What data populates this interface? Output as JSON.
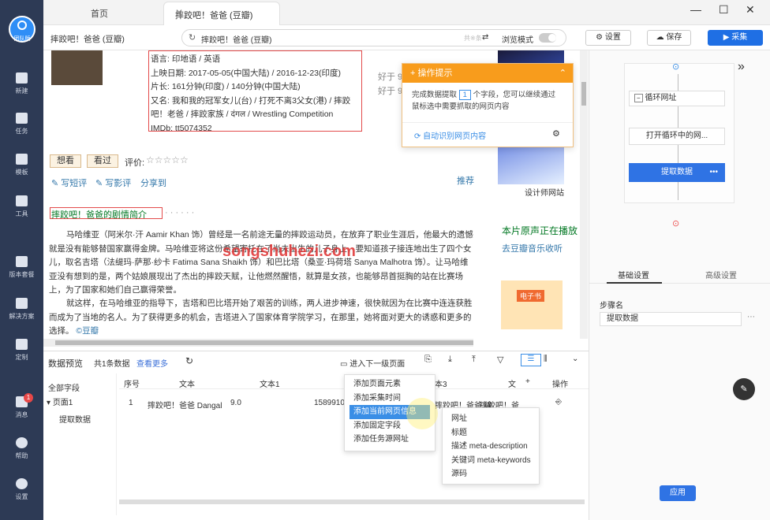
{
  "app": {
    "logo_label": "团队版"
  },
  "sidebar": [
    {
      "label": "新建"
    },
    {
      "label": "任务"
    },
    {
      "label": "模板"
    },
    {
      "label": "工具"
    },
    {
      "label": "版本套餐"
    },
    {
      "label": "解决方案"
    },
    {
      "label": "定制"
    },
    {
      "label": "消息",
      "badge": "1"
    },
    {
      "label": "帮助"
    },
    {
      "label": "设置"
    }
  ],
  "tabs": {
    "home": "首页",
    "active": "摔跤吧！爸爸 (豆瓣)"
  },
  "address": {
    "page_title": "摔跤吧！爸爸 (豆瓣)",
    "url": "摔跤吧！爸爸 (豆瓣)",
    "url_suffix": "共※条",
    "browse_mode": "浏览模式",
    "settings": "设置",
    "save": "保存",
    "collect": "采集"
  },
  "movie": {
    "lang": "语言: 印地语 / 英语",
    "release": "上映日期: 2017-05-05(中国大陆) / 2016-12-23(印度)",
    "runtime": "片长: 161分钟(印度) / 140分钟(中国大陆)",
    "aka1": "又名: 我和我的冠军女儿(台) / 打死不离3父女(港) / 摔跤",
    "aka2": "吧！老爸 / 摔跤家族 / दंगल / Wrestling Competition",
    "imdb": "IMDb: tt5074352",
    "want": "想看",
    "seen": "看过",
    "rating": "评价:",
    "stars": "☆☆☆☆☆",
    "write_short": "写短评",
    "write_review": "写影评",
    "share": "分享到",
    "recommend": "推荐",
    "designer_site": "设计师网站",
    "good1": "好于 9",
    "good2": "好于 9",
    "plot_title": "摔跤吧！爸爸的剧情简介",
    "plot_dots": "· · · · · ·",
    "plot_lines": [
      "马哈维亚（阿米尔·汗 Aamir Khan 饰）曾经是一名前途无量的摔跤运动员，在放弃了职业生涯后，他最大的遗憾",
      "就是没有能够替国家赢得金牌。马哈维亚将这份希望寄托在了尚未出生的儿子身上，要知道孩子接连地出生了四个女",
      "儿，取名吉塔（法缇玛·萨那·纱卡 Fatima Sana Shaikh 饰）和巴比塔（桑亚·玛荷塔 Sanya Malhotra 饰）。让马哈维",
      "亚没有想到的是，两个姑娘展现出了杰出的摔跤天赋，让他燃然醒悟，就算是女孩，也能够昂首挺胸的站在比赛场",
      "上，为了国家和她们自己赢得荣誉。",
      "就这样，在马哈维亚的指导下，吉塔和巴比塔开始了艰苦的训练，两人进步神速，很快就因为在比赛中连连获胜",
      "而成为了当地的名人。为了获得更多的机会，吉塔进入了国家体育学院学习，在那里，她将面对更大的诱惑和更多的",
      "选择。"
    ],
    "douban_link": "©豆瓣",
    "soundtrack": "本片原声正在播放",
    "douban_music": "去豆瓣音乐收听",
    "ebook_label": "电子书",
    "watermark": "songshuhezi.com"
  },
  "tip": {
    "title": "操作提示",
    "line1a": "完成数据提取",
    "count": "1",
    "line1b": "个字段，您可以继续通过",
    "line2": "鼠标选中需要抓取的网页内容",
    "auto": "自动识别网页内容"
  },
  "preview": {
    "title": "数据预览",
    "count": "共1条数据",
    "more": "查看更多",
    "next_level": "进入下一级页面",
    "tree_all": "全部字段",
    "tree_page": "页面1",
    "tree_item": "提取数据",
    "cols": [
      "序号",
      "文本",
      "文本1",
      "",
      "本3",
      "文",
      "操作"
    ],
    "row": {
      "no": "1",
      "t1": "摔跤吧！爸爸 Dangal",
      "t2": "9.0",
      "t3": "1589910",
      "t4": "摔跤吧！爸爸 编...",
      "t5": "摔跤吧！爸"
    }
  },
  "context_menu": [
    "添加页面元素",
    "添加采集时间",
    "添加当前网页信息",
    "添加固定字段",
    "添加任务源网址"
  ],
  "submenu": [
    "网址",
    "标题",
    "描述 meta-description",
    "关键词 meta-keywords",
    "源码"
  ],
  "flow": {
    "loop": "循环网址",
    "open": "打开循环中的网...",
    "extract": "提取数据"
  },
  "right": {
    "tab_basic": "基础设置",
    "tab_adv": "高级设置",
    "step_name_label": "步骤名",
    "step_name_value": "提取数据",
    "apply": "应用"
  }
}
